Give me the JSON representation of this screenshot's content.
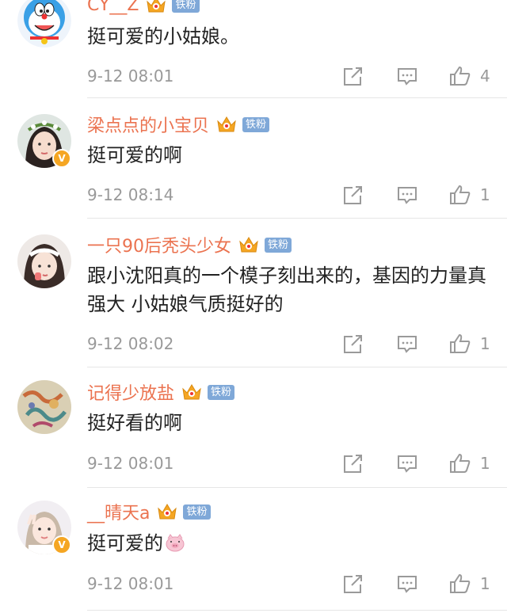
{
  "comments": [
    {
      "username": "CY__Z",
      "fan_badge": "铁粉",
      "text": "挺可爱的小姑娘。",
      "time": "9-12 08:01",
      "likes": "4",
      "avatar_icon": "doraemon-avatar-icon",
      "verified": false
    },
    {
      "username": "梁点点的小宝贝",
      "fan_badge": "铁粉",
      "text": "挺可爱的啊",
      "time": "9-12 08:14",
      "likes": "1",
      "avatar_icon": "girl-flower-crown-avatar-icon",
      "verified": true
    },
    {
      "username": "一只90后秃头少女",
      "fan_badge": "铁粉",
      "text": "跟小沈阳真的一个模子刻出来的，基因的力量真强大 小姑娘气质挺好的",
      "time": "9-12 08:02",
      "likes": "1",
      "avatar_icon": "girl-headband-avatar-icon",
      "verified": false
    },
    {
      "username": "记得少放盐",
      "fan_badge": "铁粉",
      "text": "挺好看的啊",
      "time": "9-12 08:01",
      "likes": "1",
      "avatar_icon": "painting-avatar-icon",
      "verified": false
    },
    {
      "username": "__晴天a",
      "fan_badge": "铁粉",
      "text": "挺可爱的",
      "time": "9-12 08:01",
      "likes": "1",
      "avatar_icon": "girl-peace-sign-avatar-icon",
      "verified": true,
      "trailing_emoji": "pig-face-emoji-icon"
    }
  ],
  "colors": {
    "username": "#eb7350",
    "fan_badge_bg": "#7fa8d8",
    "meta_text": "#999999",
    "icon_gray": "#9a9a9a",
    "crown": "#f5a623",
    "verified": "#f5a623"
  },
  "icons": {
    "share": "share-icon",
    "comment": "comment-icon",
    "like": "thumbs-up-icon",
    "crown": "crown-badge-icon"
  }
}
